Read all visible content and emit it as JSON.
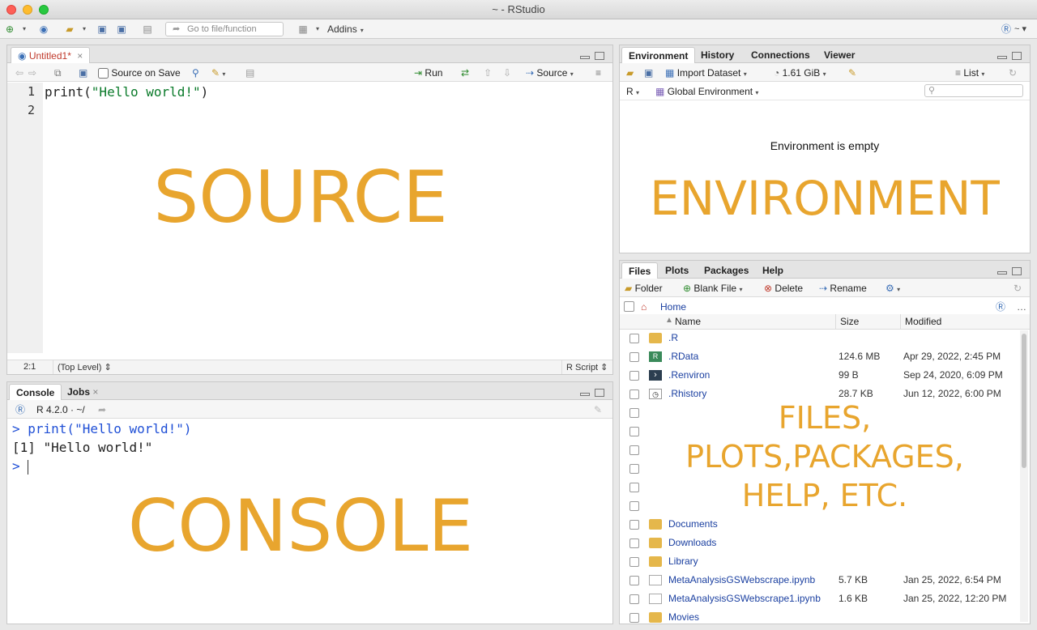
{
  "window": {
    "title": "~ - RStudio"
  },
  "toolbar": {
    "goto_placeholder": "Go to file/function",
    "addins_label": "Addins"
  },
  "source": {
    "tab_label": "Untitled1*",
    "source_on_save": "Source on Save",
    "run_label": "Run",
    "source_label": "Source",
    "line_numbers": [
      "1",
      "2"
    ],
    "code_fn": "print(",
    "code_str": "\"Hello world!\"",
    "code_end": ")",
    "cursor_pos": "2:1",
    "scope": "(Top Level)",
    "file_type": "R Script",
    "overlay": "SOURCE"
  },
  "console": {
    "tabs": [
      "Console",
      "Jobs"
    ],
    "r_version": "R 4.2.0 · ~/",
    "line1": "> print(\"Hello world!\")",
    "line2": "[1] \"Hello world!\"",
    "prompt": ">",
    "overlay": "CONSOLE"
  },
  "environment": {
    "tabs": [
      "Environment",
      "History",
      "Connections",
      "Viewer"
    ],
    "import_label": "Import Dataset",
    "memory": "1.61 GiB",
    "view_mode": "List",
    "lang": "R",
    "scope": "Global Environment",
    "empty_message": "Environment is empty",
    "overlay": "ENVIRONMENT"
  },
  "files": {
    "tabs": [
      "Files",
      "Plots",
      "Packages",
      "Help"
    ],
    "folder_btn": "Folder",
    "blank_file_btn": "Blank File",
    "delete_btn": "Delete",
    "rename_btn": "Rename",
    "path_home": "Home",
    "col_name": "Name",
    "col_size": "Size",
    "col_modified": "Modified",
    "rows": [
      {
        "name": ".R",
        "size": "",
        "modified": "",
        "icon": "folder-icon"
      },
      {
        "name": ".RData",
        "size": "124.6 MB",
        "modified": "Apr 29, 2022, 2:45 PM",
        "icon": "rdata-icon"
      },
      {
        "name": ".Renviron",
        "size": "99 B",
        "modified": "Sep 24, 2020, 6:09 PM",
        "icon": "renviron-icon"
      },
      {
        "name": ".Rhistory",
        "size": "28.7 KB",
        "modified": "Jun 12, 2022, 6:00 PM",
        "icon": "rhistory-icon"
      },
      {
        "name": "",
        "size": "",
        "modified": "",
        "icon": ""
      },
      {
        "name": "",
        "size": "",
        "modified": "",
        "icon": ""
      },
      {
        "name": "",
        "size": "",
        "modified": "",
        "icon": ""
      },
      {
        "name": "",
        "size": "",
        "modified": "",
        "icon": ""
      },
      {
        "name": "",
        "size": "",
        "modified": "",
        "icon": ""
      },
      {
        "name": "",
        "size": "",
        "modified": "",
        "icon": ""
      },
      {
        "name": "Documents",
        "size": "",
        "modified": "",
        "icon": "folder-icon"
      },
      {
        "name": "Downloads",
        "size": "",
        "modified": "",
        "icon": "folder-icon"
      },
      {
        "name": "Library",
        "size": "",
        "modified": "",
        "icon": "folder-icon"
      },
      {
        "name": "MetaAnalysisGSWebscrape.ipynb",
        "size": "5.7 KB",
        "modified": "Jan 25, 2022, 6:54 PM",
        "icon": "file-icon"
      },
      {
        "name": "MetaAnalysisGSWebscrape1.ipynb",
        "size": "1.6 KB",
        "modified": "Jan 25, 2022, 12:20 PM",
        "icon": "file-icon"
      },
      {
        "name": "Movies",
        "size": "",
        "modified": "",
        "icon": "folder-icon"
      }
    ],
    "overlay_lines": [
      "FILES,",
      "PLOTS,PACKAGES,",
      "HELP, ETC."
    ]
  },
  "colors": {
    "overlay": "#e8a52e",
    "link": "#1a3fa0",
    "console_cmd": "#1f4fd6",
    "string": "#0a7a2a"
  }
}
